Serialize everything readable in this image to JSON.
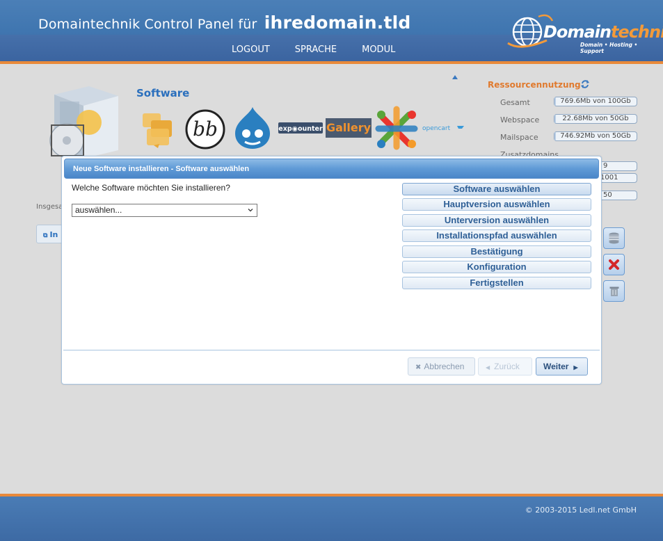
{
  "header": {
    "title_prefix": "Domaintechnik Control Panel für",
    "domain": "ihredomain.tld",
    "nav": [
      "LOGOUT",
      "SPRACHE",
      "MODUL"
    ],
    "logo_main": "Domain",
    "logo_accent": "technik",
    "logo_tagline": "Domain • Hosting • Support"
  },
  "software": {
    "title": "Software",
    "apps": [
      "phpbb-icon",
      "bb-icon",
      "drupal-icon",
      "expcounter-icon",
      "gallery-icon",
      "joomla-icon",
      "opencart-icon"
    ],
    "logo_texts": {
      "bb": "bb",
      "expcounter": "exp◉ounter",
      "gallery": "Gallery",
      "opencart": "opencart"
    }
  },
  "resources": {
    "title": "Ressourcennutzung",
    "rows": [
      {
        "label": "Gesamt",
        "value": "769.6Mb von 100Gb",
        "fill": 0.008
      },
      {
        "label": "Webspace",
        "value": "22.68Mb von 50Gb",
        "fill": 0.001
      },
      {
        "label": "Mailspace",
        "value": "746.92Mb von 50Gb",
        "fill": 0.015
      }
    ],
    "extra_label": "Zusatzdomains",
    "extra_values": [
      "9",
      "1001",
      "50"
    ]
  },
  "left": {
    "sum_label": "Insgesa",
    "button_label": "In"
  },
  "dialog": {
    "title": "Neue Software installieren - Software auswählen",
    "question": "Welche Software möchten Sie installieren?",
    "select_value": "auswählen...",
    "steps": [
      "Software auswählen",
      "Hauptversion auswählen",
      "Unterversion auswählen",
      "Installationspfad auswählen",
      "Bestätigung",
      "Konfiguration",
      "Fertigstellen"
    ],
    "active_step": 0,
    "buttons": {
      "cancel": "Abbrechen",
      "back": "Zurück",
      "next": "Weiter"
    }
  },
  "footer": {
    "copyright": "© 2003-2015 Ledl.net GmbH"
  },
  "colors": {
    "accent": "#e8893a",
    "brand_blue": "#4076b0",
    "link_blue": "#2a6fbd"
  }
}
